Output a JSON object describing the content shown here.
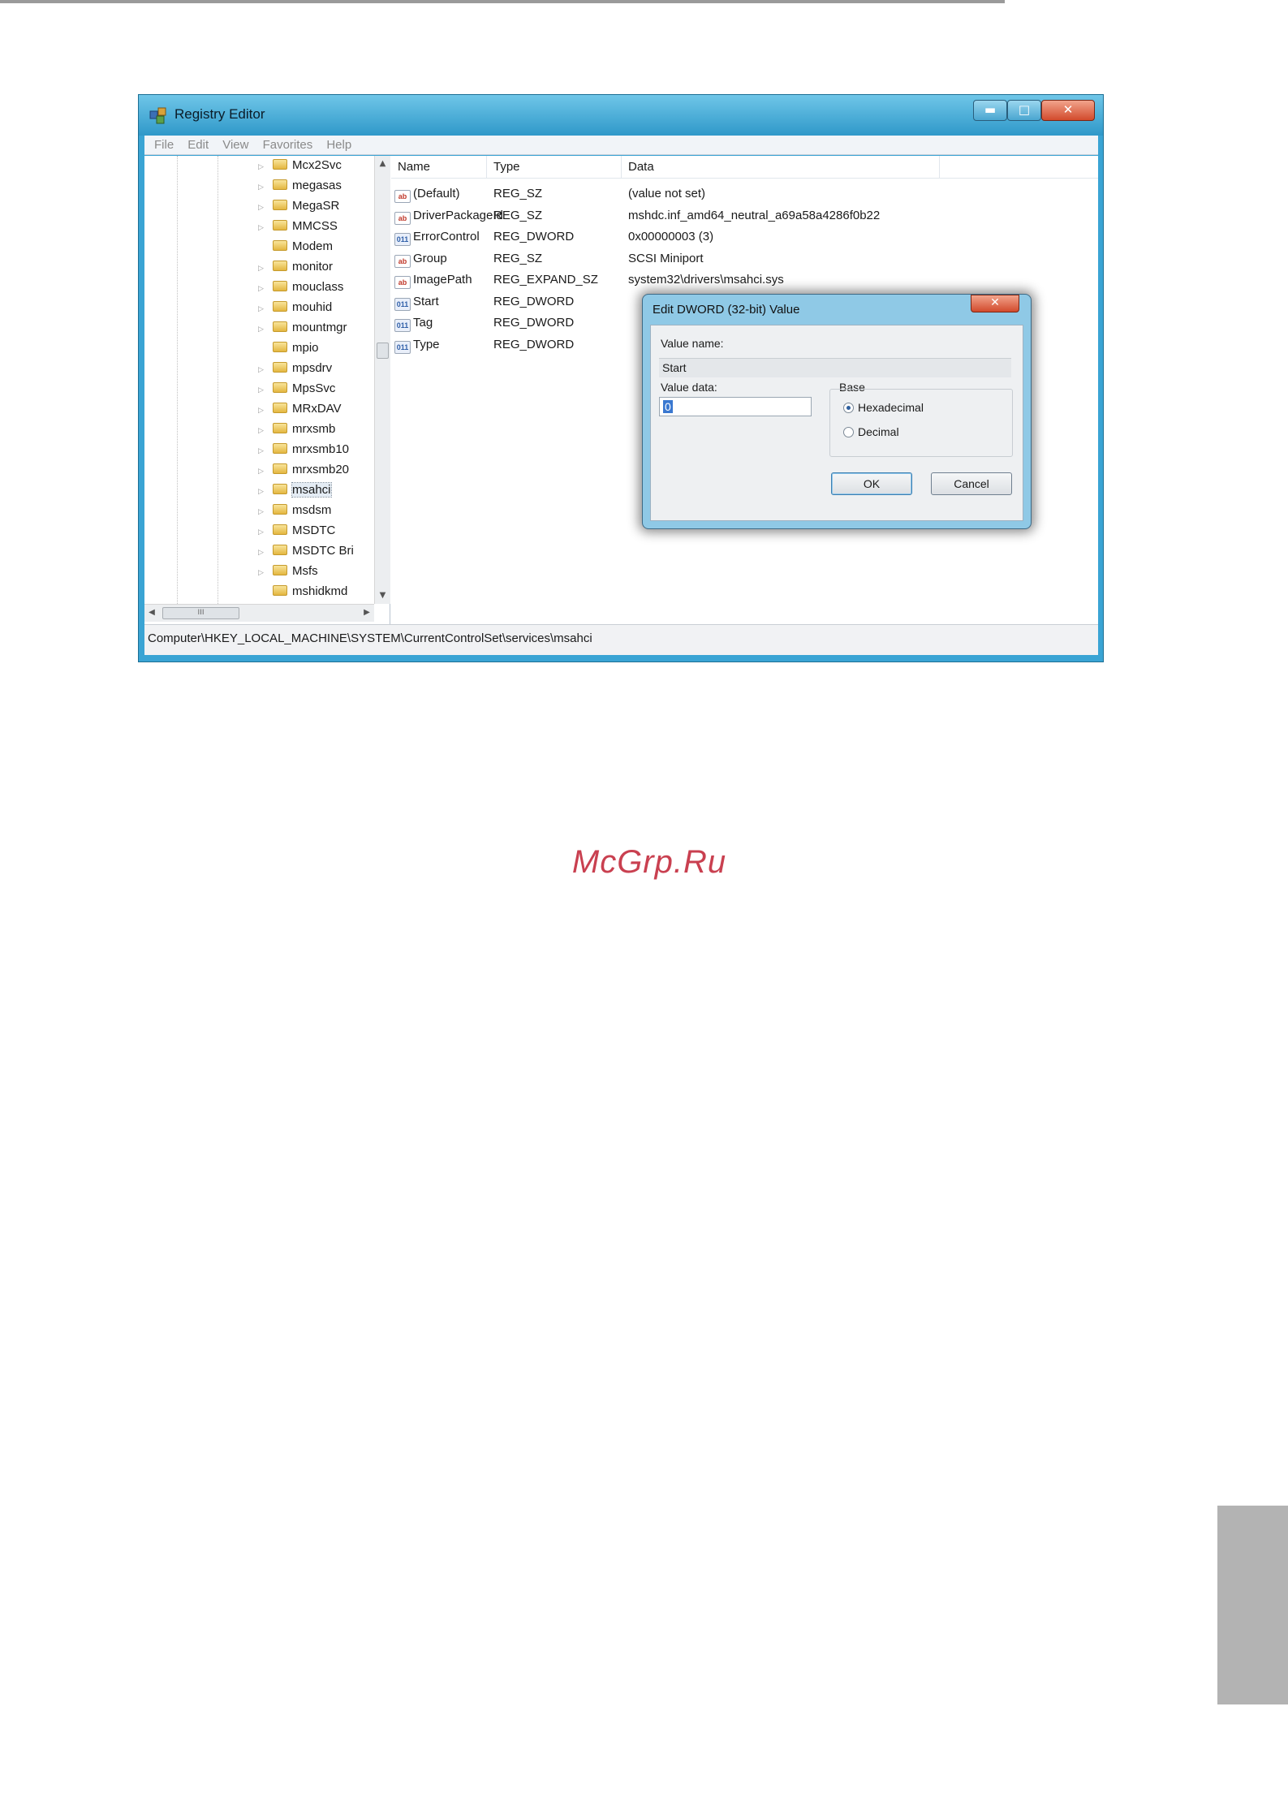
{
  "window": {
    "title": "Registry Editor",
    "controls": {
      "minimize": "▬",
      "maximize": "□",
      "close": "✕"
    }
  },
  "menu": [
    "File",
    "Edit",
    "View",
    "Favorites",
    "Help"
  ],
  "tree": {
    "items": [
      {
        "label": "Mcx2Svc",
        "expandable": true
      },
      {
        "label": "megasas",
        "expandable": true
      },
      {
        "label": "MegaSR",
        "expandable": true
      },
      {
        "label": "MMCSS",
        "expandable": true
      },
      {
        "label": "Modem",
        "expandable": false
      },
      {
        "label": "monitor",
        "expandable": true
      },
      {
        "label": "mouclass",
        "expandable": true
      },
      {
        "label": "mouhid",
        "expandable": true
      },
      {
        "label": "mountmgr",
        "expandable": true
      },
      {
        "label": "mpio",
        "expandable": false
      },
      {
        "label": "mpsdrv",
        "expandable": true
      },
      {
        "label": "MpsSvc",
        "expandable": true
      },
      {
        "label": "MRxDAV",
        "expandable": true
      },
      {
        "label": "mrxsmb",
        "expandable": true
      },
      {
        "label": "mrxsmb10",
        "expandable": true
      },
      {
        "label": "mrxsmb20",
        "expandable": true
      },
      {
        "label": "msahci",
        "expandable": true,
        "selected": true
      },
      {
        "label": "msdsm",
        "expandable": true
      },
      {
        "label": "MSDTC",
        "expandable": true
      },
      {
        "label": "MSDTC Bri",
        "expandable": true
      },
      {
        "label": "Msfs",
        "expandable": true
      },
      {
        "label": "mshidkmd",
        "expandable": false
      }
    ],
    "hscroll_thumb": "III"
  },
  "list": {
    "columns": [
      "Name",
      "Type",
      "Data"
    ],
    "rows": [
      {
        "icon": "ab",
        "name": "(Default)",
        "type": "REG_SZ",
        "data": "(value not set)"
      },
      {
        "icon": "ab",
        "name": "DriverPackageId",
        "type": "REG_SZ",
        "data": "mshdc.inf_amd64_neutral_a69a58a4286f0b22"
      },
      {
        "icon": "dword",
        "name": "ErrorControl",
        "type": "REG_DWORD",
        "data": "0x00000003 (3)"
      },
      {
        "icon": "ab",
        "name": "Group",
        "type": "REG_SZ",
        "data": "SCSI Miniport"
      },
      {
        "icon": "ab",
        "name": "ImagePath",
        "type": "REG_EXPAND_SZ",
        "data": "system32\\drivers\\msahci.sys"
      },
      {
        "icon": "dword",
        "name": "Start",
        "type": "REG_DWORD",
        "data": ""
      },
      {
        "icon": "dword",
        "name": "Tag",
        "type": "REG_DWORD",
        "data": ""
      },
      {
        "icon": "dword",
        "name": "Type",
        "type": "REG_DWORD",
        "data": ""
      }
    ]
  },
  "status": "Computer\\HKEY_LOCAL_MACHINE\\SYSTEM\\CurrentControlSet\\services\\msahci",
  "dialog": {
    "title": "Edit DWORD (32-bit) Value",
    "close": "✕",
    "value_name_label": "Value name:",
    "value_name": "Start",
    "value_data_label": "Value data:",
    "value_data": "0",
    "base_label": "Base",
    "base_options": [
      {
        "label": "Hexadecimal",
        "selected": true
      },
      {
        "label": "Decimal",
        "selected": false
      }
    ],
    "ok": "OK",
    "cancel": "Cancel"
  },
  "watermark": "McGrp.Ru"
}
